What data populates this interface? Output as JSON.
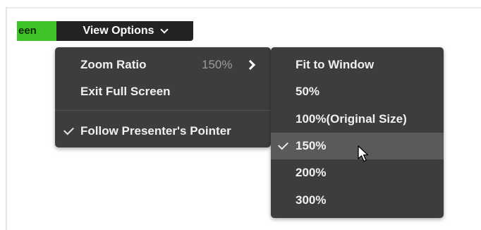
{
  "toolbar": {
    "green_tab_label": "een",
    "view_options_label": "View Options"
  },
  "main_menu": {
    "zoom_ratio_label": "Zoom Ratio",
    "zoom_ratio_value": "150%",
    "exit_full_screen_label": "Exit Full Screen",
    "follow_pointer_label": "Follow Presenter's Pointer",
    "follow_pointer_checked": true
  },
  "zoom_submenu": {
    "items": [
      {
        "label": "Fit to Window"
      },
      {
        "label": "50%"
      },
      {
        "label": "100%(Original Size)"
      },
      {
        "label": "150%",
        "selected": true
      },
      {
        "label": "200%"
      },
      {
        "label": "300%"
      }
    ]
  },
  "colors": {
    "menu_bg": "#3d3d3d",
    "toolbar_bg": "#232323",
    "green_tab": "#3fc428",
    "selected_item_bg": "#5a5a5a"
  },
  "icons": [
    "chevron-down-icon",
    "chevron-right-icon",
    "checkmark-icon",
    "mouse-cursor-icon"
  ]
}
